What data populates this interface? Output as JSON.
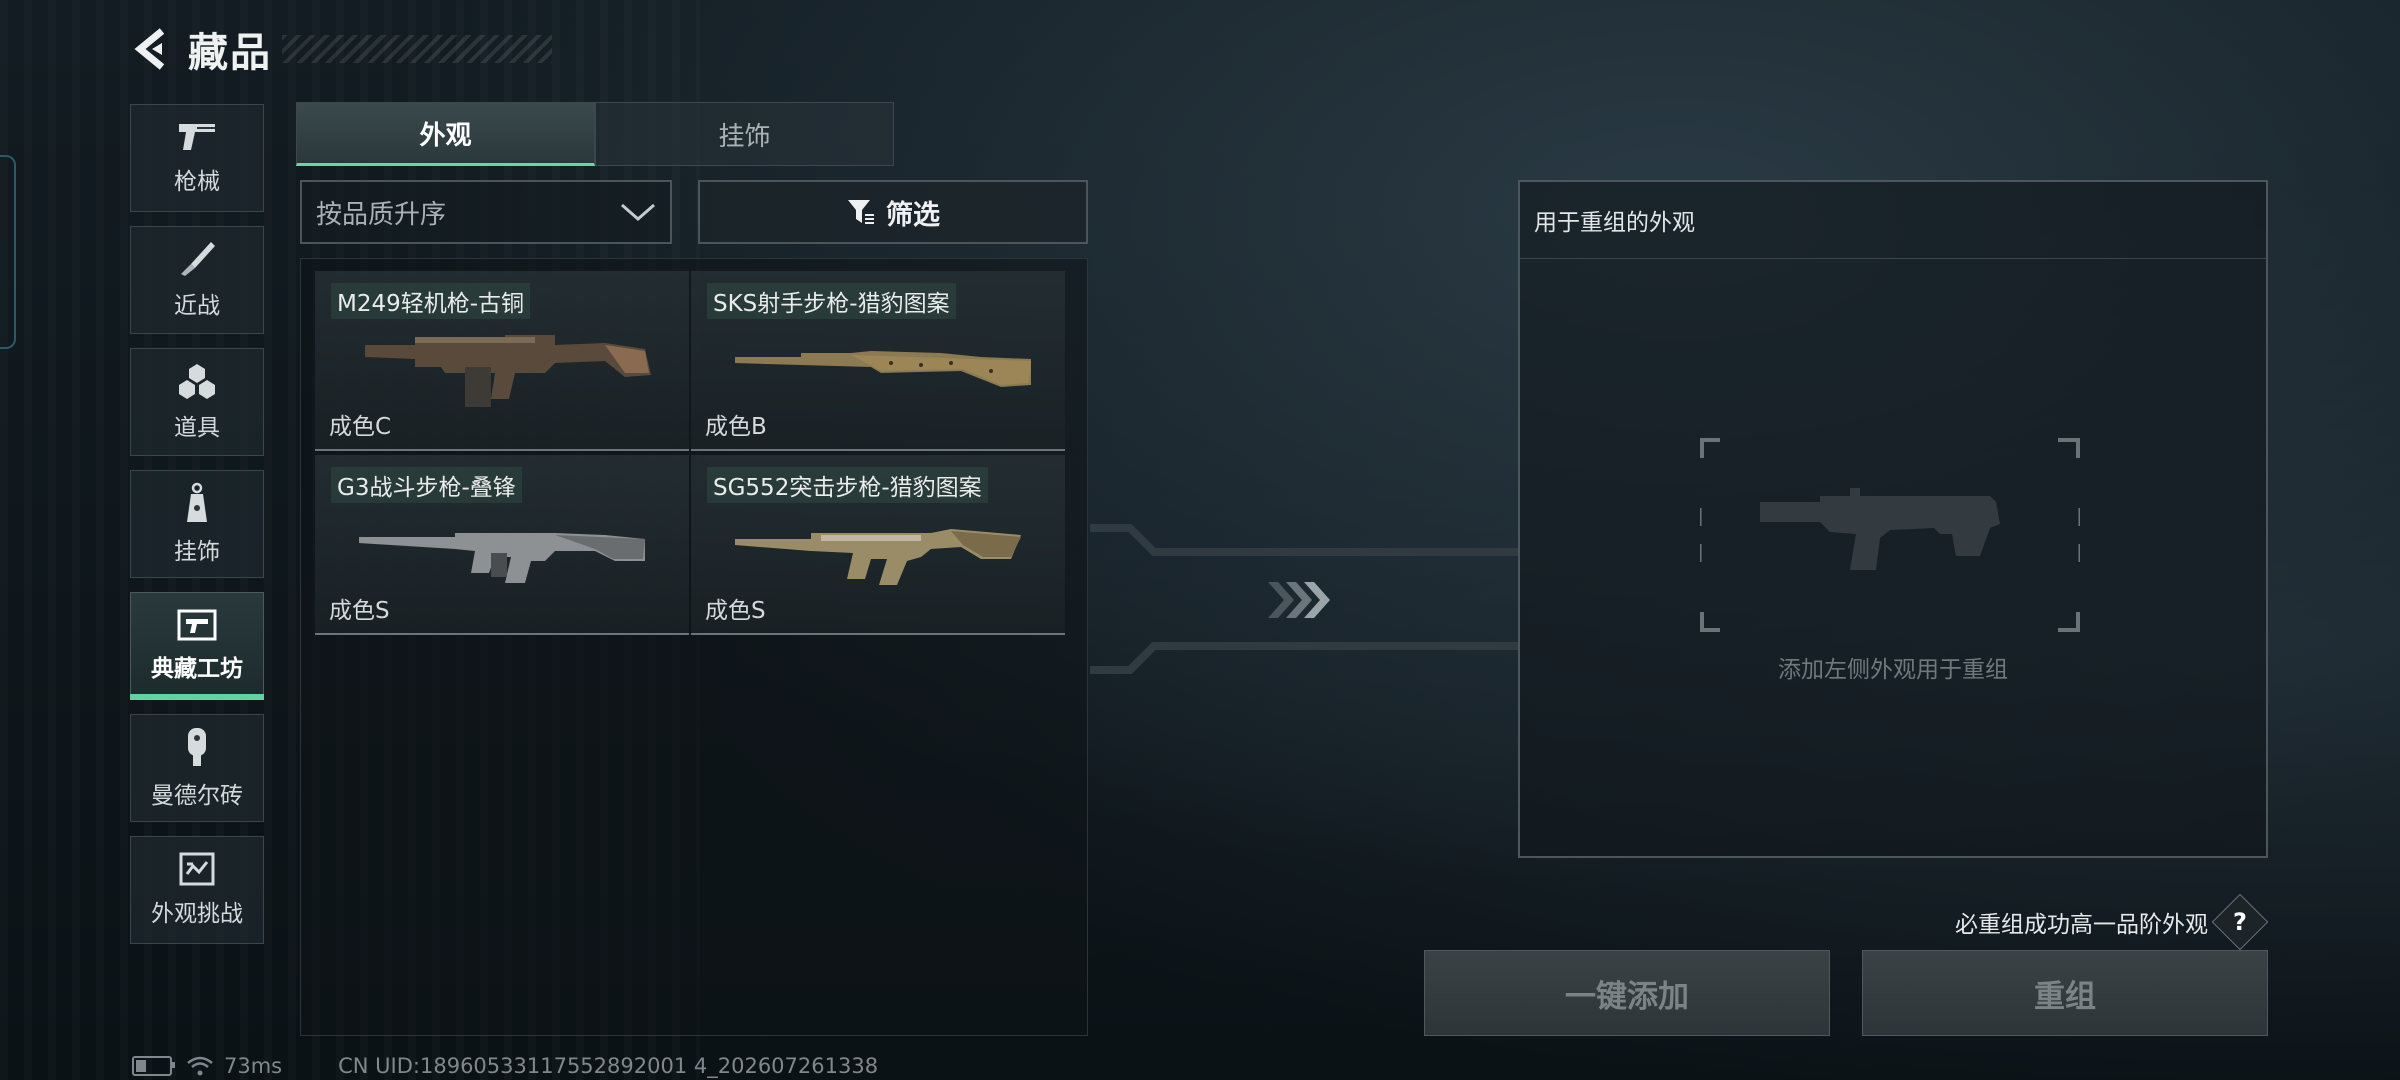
{
  "header": {
    "title": "藏品"
  },
  "sidebar": {
    "items": [
      {
        "label": "枪械",
        "icon": "pistol-icon"
      },
      {
        "label": "近战",
        "icon": "knife-icon"
      },
      {
        "label": "道具",
        "icon": "grenades-icon"
      },
      {
        "label": "挂饰",
        "icon": "charm-icon"
      },
      {
        "label": "典藏工坊",
        "icon": "workshop-icon",
        "active": true
      },
      {
        "label": "曼德尔砖",
        "icon": "mandel-brick-icon"
      },
      {
        "label": "外观挑战",
        "icon": "challenge-icon"
      }
    ]
  },
  "tabs": [
    {
      "label": "外观",
      "active": true
    },
    {
      "label": "挂饰",
      "active": false
    }
  ],
  "sort": {
    "value": "按品质升序"
  },
  "filter": {
    "label": "筛选"
  },
  "items": [
    {
      "name": "M249轻机枪-古铜",
      "grade": "成色C"
    },
    {
      "name": "SKS射手步枪-猎豹图案",
      "grade": "成色B"
    },
    {
      "name": "G3战斗步枪-叠锋",
      "grade": "成色S"
    },
    {
      "name": "SG552突击步枪-猎豹图案",
      "grade": "成色S"
    }
  ],
  "recombine": {
    "header": "用于重组的外观",
    "hint": "添加左侧外观用于重组",
    "note": "必重组成功高一品阶外观",
    "help": "?",
    "add_all_label": "一键添加",
    "recombine_label": "重组"
  },
  "status": {
    "ping": "73ms",
    "uid": "CN UID:18960533117552892001 4_202607261338"
  },
  "colors": {
    "accent": "#5fd4a0"
  }
}
